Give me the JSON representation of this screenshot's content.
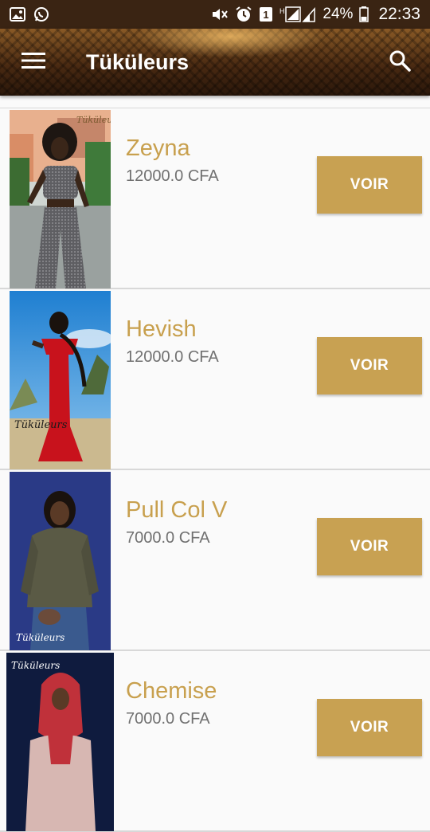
{
  "status_bar": {
    "battery": "24%",
    "time": "22:33",
    "icons": [
      "image-icon",
      "whatsapp-icon",
      "mute-icon",
      "alarm-icon",
      "sim1-icon",
      "signal-icon",
      "battery-icon"
    ]
  },
  "app_bar": {
    "title": "Tüküleurs",
    "menu_icon": "hamburger-menu-icon",
    "search_icon": "search-icon"
  },
  "products": [
    {
      "name": "Zeyna",
      "price": "12000.0 CFA",
      "button": "VOIR"
    },
    {
      "name": "Hevish",
      "price": "12000.0 CFA",
      "button": "VOIR"
    },
    {
      "name": "Pull Col V",
      "price": "7000.0 CFA",
      "button": "VOIR"
    },
    {
      "name": "Chemise",
      "price": "7000.0 CFA",
      "button": "VOIR"
    }
  ],
  "colors": {
    "accent": "#c8a152",
    "name_text": "#c8a04e",
    "price_text": "#707070",
    "status_bar": "#3a2413"
  }
}
